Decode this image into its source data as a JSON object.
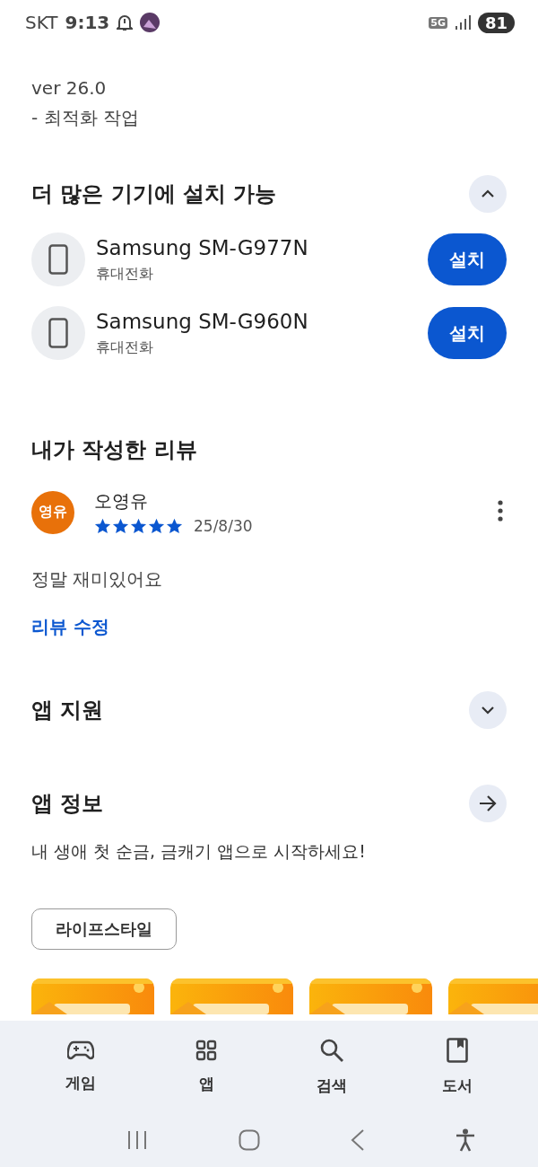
{
  "status_bar": {
    "carrier": "SKT",
    "time": "9:13",
    "network": "5G",
    "battery": "81"
  },
  "whats_new": {
    "version": "ver 26.0",
    "notes": "- 최적화 작업"
  },
  "devices_section": {
    "title": "더 많은 기기에 설치 가능",
    "expanded": true,
    "devices": [
      {
        "name": "Samsung SM-G977N",
        "type": "휴대전화",
        "button": "설치"
      },
      {
        "name": "Samsung SM-G960N",
        "type": "휴대전화",
        "button": "설치"
      }
    ]
  },
  "my_review": {
    "title": "내가 작성한 리뷰",
    "avatar": "영유",
    "author": "오영유",
    "stars": 5,
    "date": "25/8/30",
    "text": "정말 재미있어요",
    "edit_link": "리뷰 수정"
  },
  "app_support": {
    "title": "앱 지원",
    "expanded": false
  },
  "app_info": {
    "title": "앱 정보",
    "description": "내 생애 첫 순금, 금캐기 앱으로 시작하세요!",
    "category": "라이프스타일"
  },
  "bottom_nav": [
    {
      "label": "게임",
      "kind": "games"
    },
    {
      "label": "앱",
      "kind": "apps"
    },
    {
      "label": "검색",
      "kind": "search"
    },
    {
      "label": "도서",
      "kind": "books"
    }
  ]
}
